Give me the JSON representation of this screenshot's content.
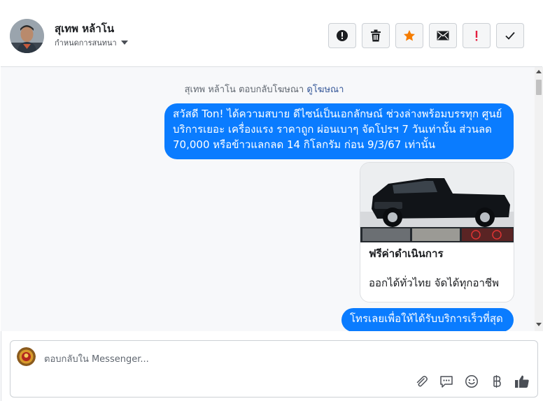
{
  "header": {
    "contact_name": "สุเทพ หล้าโน",
    "assign_label": "กำหนดการสนทนา"
  },
  "toolbar": {
    "buttons": [
      "spam",
      "delete",
      "star",
      "mark-unread",
      "important",
      "done"
    ],
    "star_color": "#f57c00",
    "alert_color": "#e41e3f"
  },
  "conversation": {
    "notice_text": "สุเทพ หล้าโน ตอบกลับโฆษณา",
    "notice_link": "ดูโฆษณา",
    "message_1": "สวัสดี Ton! ได้ความสบาย ดีไซน์เป็นเอกลักษณ์ ช่วงล่างพร้อมบรรทุก ศูนย์บริการเยอะ เครื่องแรง ราคาถูก ผ่อนเบาๆ จัดโปรฯ 7 วันเท่านั้น ส่วนลด 70,000 หรือข้าวแลกลด 14 กิโลกรัม ก่อน 9/3/67 เท่านั้น",
    "card_title": "ฟรีค่าดำเนินการ",
    "card_description": "ออกได้ทั่วไทย จัดได้ทุกอาชีพ",
    "message_2": "โทรเลยเพื่อให้ได้รับบริการเร็วที่สุด",
    "bubble_color": "#0a7cff"
  },
  "composer": {
    "placeholder": "ตอบกลับใน Messenger...",
    "icons": [
      "attachment",
      "saved-replies",
      "emoji",
      "baht-payment",
      "like"
    ]
  }
}
